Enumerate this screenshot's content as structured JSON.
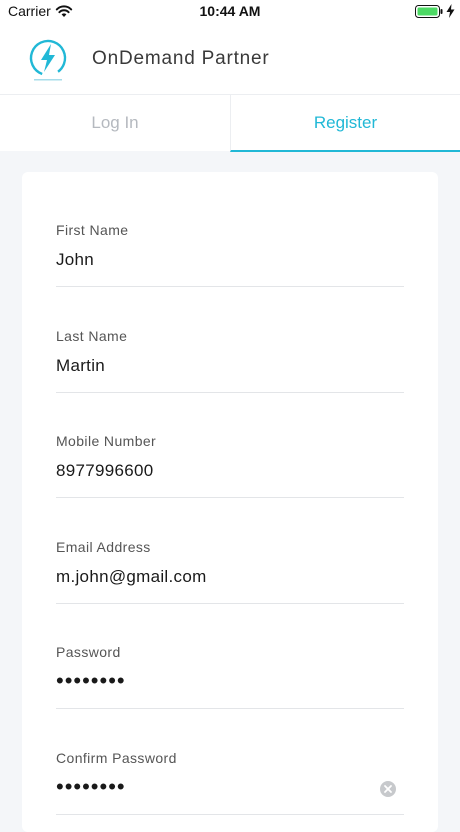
{
  "status_bar": {
    "carrier": "Carrier",
    "time": "10:44 AM",
    "battery_color": "#4cd964"
  },
  "header": {
    "title": "OnDemand Partner",
    "logo_icon": "lightning-bolt-logo",
    "accent_color": "#21b8d6"
  },
  "tabs": [
    {
      "label": "Log In",
      "active": false
    },
    {
      "label": "Register",
      "active": true
    }
  ],
  "form": {
    "fields": [
      {
        "label": "First Name",
        "value": "John"
      },
      {
        "label": "Last Name",
        "value": "Martin"
      },
      {
        "label": "Mobile Number",
        "value": "8977996600"
      },
      {
        "label": "Email Address",
        "value": "m.john@gmail.com"
      },
      {
        "label": "Password",
        "value": "••••••••"
      },
      {
        "label": "Confirm Password",
        "value": "••••••••"
      }
    ]
  }
}
